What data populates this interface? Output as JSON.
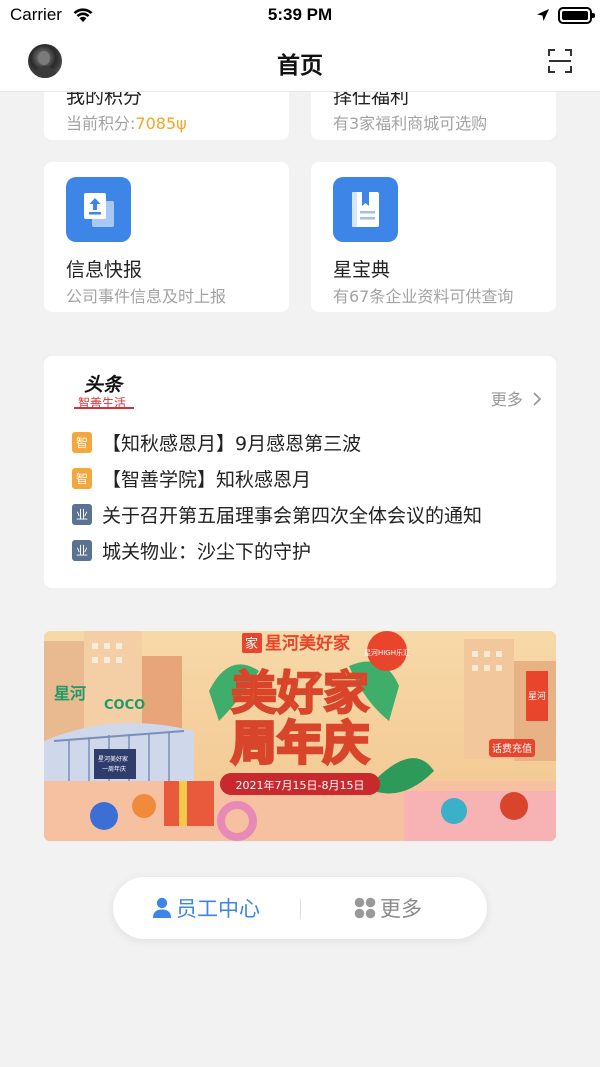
{
  "status_bar": {
    "carrier": "Carrier",
    "time": "5:39 PM"
  },
  "header": {
    "title": "首页"
  },
  "cards": {
    "points": {
      "title": "我的积分",
      "sub_prefix": "当前积分:",
      "value": "7085ψ"
    },
    "welfare": {
      "title": "择任福利",
      "sub": "有3家福利商城可选购"
    },
    "news_report": {
      "title": "信息快报",
      "sub": "公司事件信息及时上报",
      "icon": "upload-doc-icon"
    },
    "star_book": {
      "title": "星宝典",
      "sub": "有67条企业资料可供查询",
      "icon": "book-icon"
    }
  },
  "headlines": {
    "logo_line1": "头条",
    "logo_line2": "智善生活",
    "more_label": "更多",
    "items": [
      {
        "tag": "智",
        "text": "【知秋感恩月】9月感恩第三波"
      },
      {
        "tag": "智",
        "text": "【智善学院】知秋感恩月"
      },
      {
        "tag": "业",
        "text": "关于召开第五届理事会第四次全体会议的通知"
      },
      {
        "tag": "业",
        "text": "城关物业：沙尘下的守护"
      }
    ]
  },
  "banner": {
    "brand": "星河美好家",
    "brand_tag": "家",
    "title_line1": "美好家",
    "title_line2": "周年庆",
    "dates": "2021年7月15日-8月15日",
    "recharge": "话费充值",
    "sign_left": "星河",
    "sign_right": "COCO",
    "poster_line1": "星河美好家",
    "poster_line2": "一周年庆",
    "sign_tower": "星河",
    "bubble": "星河HIGH乐汇"
  },
  "tabs": {
    "staff_label": "员工中心",
    "more_label": "更多"
  },
  "colors": {
    "accent": "#3d86e8",
    "points": "#f5a623",
    "badge_orange": "#f4a73c",
    "badge_slate": "#5b7293"
  }
}
